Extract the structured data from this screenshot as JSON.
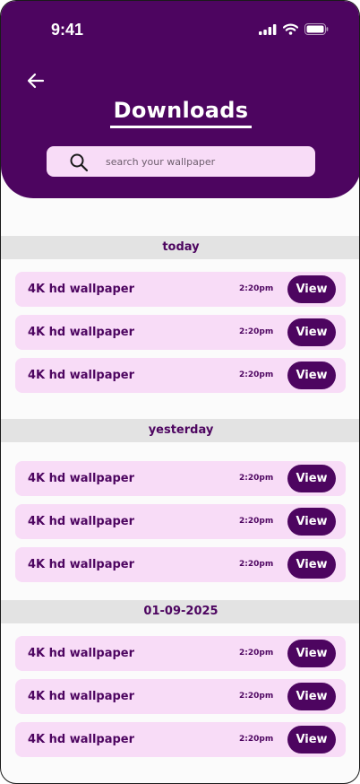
{
  "status_bar": {
    "time": "9:41"
  },
  "header": {
    "title": "Downloads"
  },
  "search": {
    "placeholder": "search your wallpaper"
  },
  "sections": [
    {
      "label": "today",
      "items": [
        {
          "title": "4K hd wallpaper",
          "time": "2:20pm",
          "action": "View"
        },
        {
          "title": "4K hd wallpaper",
          "time": "2:20pm",
          "action": "View"
        },
        {
          "title": "4K hd wallpaper",
          "time": "2:20pm",
          "action": "View"
        }
      ]
    },
    {
      "label": "yesterday",
      "items": [
        {
          "title": "4K hd wallpaper",
          "time": "2:20pm",
          "action": "View"
        },
        {
          "title": "4K hd wallpaper",
          "time": "2:20pm",
          "action": "View"
        },
        {
          "title": "4K hd wallpaper",
          "time": "2:20pm",
          "action": "View"
        }
      ]
    },
    {
      "label": "01-09-2025",
      "items": [
        {
          "title": "4K hd wallpaper",
          "time": "2:20pm",
          "action": "View"
        },
        {
          "title": "4K hd wallpaper",
          "time": "2:20pm",
          "action": "View"
        },
        {
          "title": "4K hd wallpaper",
          "time": "2:20pm",
          "action": "View"
        }
      ]
    }
  ],
  "colors": {
    "primary": "#4d0560",
    "card": "#f8dcf7",
    "section_bg": "#e3e3e3",
    "page_bg": "#fbfbfb"
  }
}
